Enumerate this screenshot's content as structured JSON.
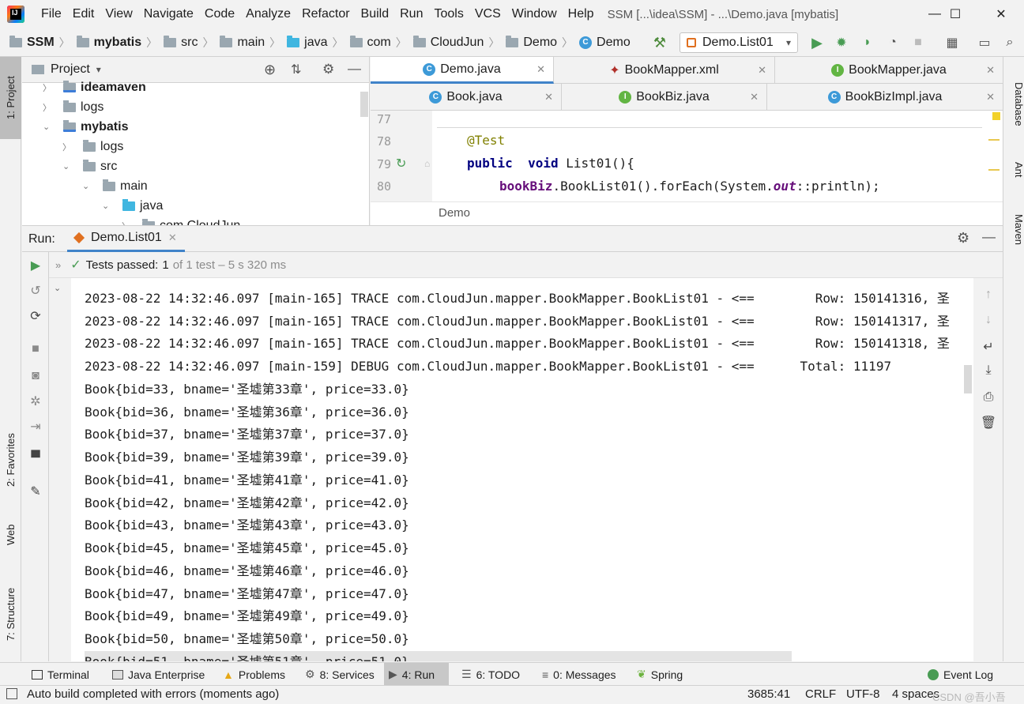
{
  "window": {
    "title": "SSM [...\\idea\\SSM] - ...\\Demo.java [mybatis]",
    "logo_text": "IJ"
  },
  "menu": [
    "File",
    "Edit",
    "View",
    "Navigate",
    "Code",
    "Analyze",
    "Refactor",
    "Build",
    "Run",
    "Tools",
    "VCS",
    "Window",
    "Help"
  ],
  "navbar": {
    "breadcrumbs": [
      "SSM",
      "mybatis",
      "src",
      "main",
      "java",
      "com",
      "CloudJun",
      "Demo",
      "Demo"
    ],
    "run_config": "Demo.List01"
  },
  "left_tabs": {
    "project": "1: Project",
    "favorites": "2: Favorites",
    "web": "Web",
    "structure": "7: Structure"
  },
  "right_tabs": {
    "database": "Database",
    "ant": "Ant",
    "maven": "Maven"
  },
  "project_panel": {
    "title": "Project",
    "tree": [
      {
        "label": "ideamaven",
        "bold": true
      },
      {
        "label": "logs",
        "bold": false
      },
      {
        "label": "mybatis",
        "bold": true
      },
      {
        "label": "logs",
        "bold": false
      },
      {
        "label": "src",
        "bold": false
      },
      {
        "label": "main",
        "bold": false
      },
      {
        "label": "java",
        "bold": false
      },
      {
        "label": "com.CloudJun",
        "bold": false
      }
    ]
  },
  "editor": {
    "tabs_row1": [
      "Demo.java",
      "BookMapper.xml",
      "BookMapper.java"
    ],
    "tabs_row2": [
      "Book.java",
      "BookBiz.java",
      "BookBizImpl.java"
    ],
    "line_numbers": [
      "77",
      "78",
      "79",
      "80"
    ],
    "code": {
      "annotation": "@Test",
      "kw_public": "public",
      "kw_void": "void",
      "method_decl": "List01(){",
      "field": "bookBiz",
      "call1": ".BookList01().forEach(System.",
      "static_field": "out",
      "call2": "::println);"
    },
    "breadcrumb": "Demo"
  },
  "run_panel": {
    "label": "Run:",
    "tab": "Demo.List01",
    "status_prefix": "Tests passed:",
    "status_count": "1",
    "status_suffix": "of 1 test – 5 s 320 ms",
    "console_lines": [
      "2023-08-22 14:32:46.097 [main-165] TRACE com.CloudJun.mapper.BookMapper.BookList01 - <==        Row: 150141316, 圣",
      "2023-08-22 14:32:46.097 [main-165] TRACE com.CloudJun.mapper.BookMapper.BookList01 - <==        Row: 150141317, 圣",
      "2023-08-22 14:32:46.097 [main-165] TRACE com.CloudJun.mapper.BookMapper.BookList01 - <==        Row: 150141318, 圣",
      "2023-08-22 14:32:46.097 [main-159] DEBUG com.CloudJun.mapper.BookMapper.BookList01 - <==      Total: 11197",
      "Book{bid=33, bname='圣墟第33章', price=33.0}",
      "Book{bid=36, bname='圣墟第36章', price=36.0}",
      "Book{bid=37, bname='圣墟第37章', price=37.0}",
      "Book{bid=39, bname='圣墟第39章', price=39.0}",
      "Book{bid=41, bname='圣墟第41章', price=41.0}",
      "Book{bid=42, bname='圣墟第42章', price=42.0}",
      "Book{bid=43, bname='圣墟第43章', price=43.0}",
      "Book{bid=45, bname='圣墟第45章', price=45.0}",
      "Book{bid=46, bname='圣墟第46章', price=46.0}",
      "Book{bid=47, bname='圣墟第47章', price=47.0}",
      "Book{bid=49, bname='圣墟第49章', price=49.0}",
      "Book{bid=50, bname='圣墟第50章', price=50.0}",
      "Book{bid=51, bname='圣墟第51章', price=51.0}"
    ]
  },
  "bottom_tools": [
    {
      "label": "Terminal",
      "icon": "terminal-icon"
    },
    {
      "label": "Java Enterprise",
      "icon": "java-enterprise-icon"
    },
    {
      "label": "Problems",
      "icon": "warning-icon"
    },
    {
      "label": "8: Services",
      "icon": "services-icon"
    },
    {
      "label": "4: Run",
      "icon": "run-icon"
    },
    {
      "label": "6: TODO",
      "icon": "todo-icon"
    },
    {
      "label": "0: Messages",
      "icon": "messages-icon"
    },
    {
      "label": "Spring",
      "icon": "spring-icon"
    },
    {
      "label": "Event Log",
      "icon": "event-log-icon"
    }
  ],
  "statusbar": {
    "message": "Auto build completed with errors (moments ago)",
    "position": "3685:41",
    "line_sep": "CRLF",
    "encoding": "UTF-8",
    "indent": "4 spaces",
    "watermark": "CSDN @吾小吾"
  },
  "colors": {
    "accent": "#4083c9",
    "keyword": "#000080",
    "annotation": "#808000",
    "field": "#660e7a",
    "run_green": "#499c54"
  }
}
